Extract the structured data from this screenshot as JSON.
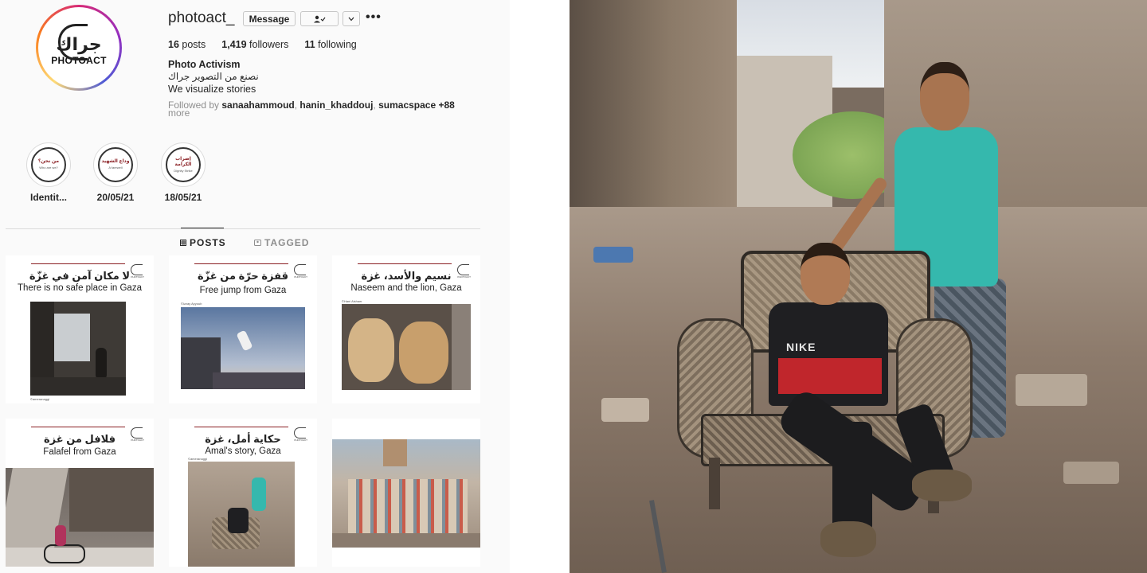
{
  "profile": {
    "username": "photoact_",
    "message_label": "Message",
    "follow_icon": "person-check-icon",
    "chevron_icon": "chevron-down-icon",
    "more_icon": "more-dots-icon",
    "avatar": {
      "logo_arabic": "جراك",
      "logo_latin": "PHOTOACT"
    },
    "stats": {
      "posts_count": "16",
      "posts_label": "posts",
      "followers_count": "1,419",
      "followers_label": "followers",
      "following_count": "11",
      "following_label": "following"
    },
    "full_name": "Photo Activism",
    "bio_arabic": "نصنع من التصوير جراك",
    "bio_english": "We visualize stories",
    "followed_by": {
      "prefix": "Followed by",
      "users": [
        "sanaahammoud",
        "hanin_khaddouj",
        "sumacspace"
      ],
      "suffix": "+88",
      "more": "more"
    }
  },
  "highlights": [
    {
      "label": "Identit...",
      "cover_ar": "من نحن؟",
      "cover_en": "Who are we?"
    },
    {
      "label": "20/05/21",
      "cover_ar": "وداع الشهيد",
      "cover_en": "A farewell"
    },
    {
      "label": "18/05/21",
      "cover_ar": "إضراب الكرامة",
      "cover_en": "Dignity Strike"
    }
  ],
  "tabs": {
    "posts": "POSTS",
    "posts_icon": "grid-icon",
    "tagged": "TAGGED",
    "tagged_icon": "tag-person-icon"
  },
  "posts": [
    {
      "title_ar": "لا مكان آمن في غزّة",
      "title_en": "There is no safe place in Gaza",
      "credit": "©ameranaggi"
    },
    {
      "title_ar": "قفزة حرّة من غزّة",
      "title_en": "Free jump from Gaza",
      "credit": "©Izzay Ayyoub"
    },
    {
      "title_ar": "نسيم والأسد، غزة",
      "title_en": "Naseem and the lion, Gaza",
      "credit": "©Hani Alshaer"
    },
    {
      "title_ar": "فلافل من غزة",
      "title_en": "Falafel from Gaza",
      "credit": ""
    },
    {
      "title_ar": "حكاية أمل، غزة",
      "title_en": "Amal's story, Gaza",
      "credit": "©ameranaggi"
    },
    {
      "title_ar": "",
      "title_en": "",
      "credit": ""
    }
  ],
  "post_logo_text": "PHOTOACT",
  "photo": {
    "shirt_text": "NIKE"
  },
  "colors": {
    "accent_red": "#8a1f23",
    "girl_shirt": "#35b8ad",
    "boy_shirt_red": "#c0262c"
  }
}
